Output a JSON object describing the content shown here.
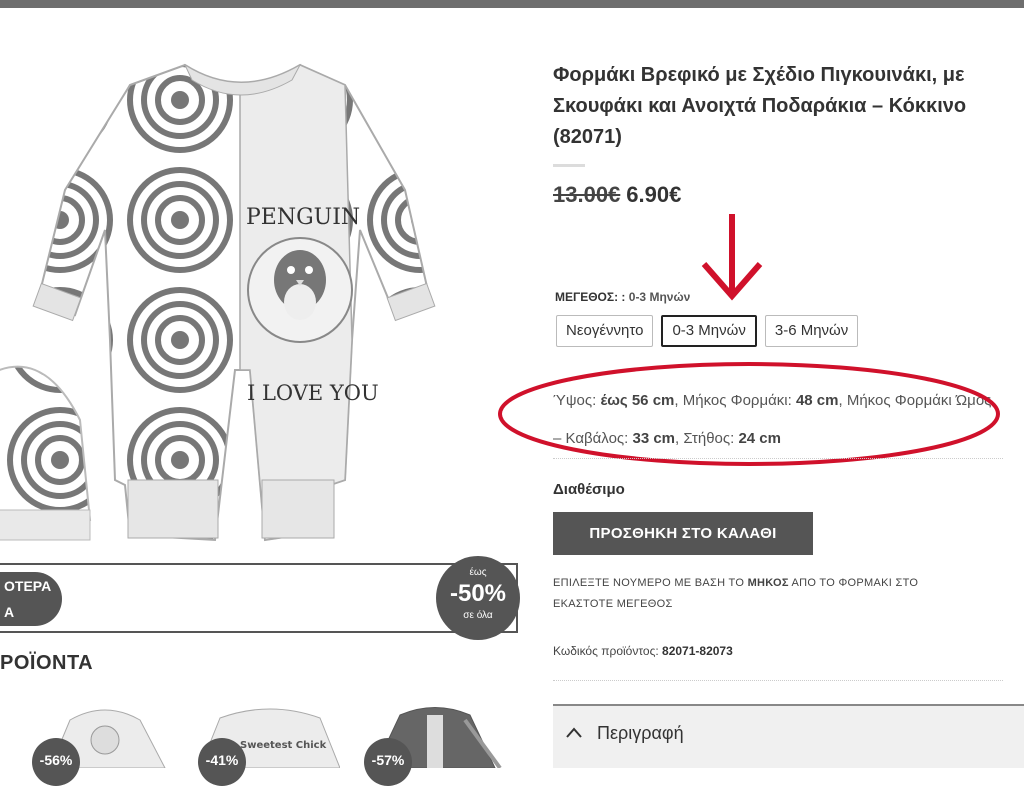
{
  "product": {
    "title": "Φορμάκι Βρεφικό με Σχέδιο Πιγκουινάκι, με Σκουφάκι και Ανοιχτά Ποδαράκια – Κόκκινο (82071)",
    "price_old": "13.00€",
    "price_new": "6.90€",
    "image_texts": {
      "penguin": "PENGUIN",
      "love": "I LOVE YOU"
    },
    "size": {
      "label": "ΜΕΓΕΘΟΣ: :",
      "selected_value": "0-3 Μηνών",
      "options": [
        "Νεογέννητο",
        "0-3 Μηνών",
        "3-6 Μηνών"
      ]
    },
    "dimensions": {
      "height_label": "Ύψος: ",
      "height_value": "έως 56 cm",
      "length_label": ", Μήκος Φορμάκι: ",
      "length_value": "48 cm",
      "line2_prefix": ", Μήκος Φορμάκι Ώμος – Καβάλος: ",
      "shoulder_value": "33 cm",
      "chest_label": ", Στήθος: ",
      "chest_value": "24 cm"
    },
    "availability": "Διαθέσιμο",
    "add_to_cart": "ΠΡΟΣΘΗΚΗ ΣΤΟ ΚΑΛΑΘΙ",
    "note_part1": "ΕΠΙΛΕΞΤΕ ΝΟΥΜΕΡΟ ΜΕ ΒΑΣΗ ΤΟ ",
    "note_bold": "ΜΗΚΟΣ",
    "note_part2": " ΑΠΟ ΤΟ ΦΟΡΜΑΚΙ ΣΤΟ ΕΚΑΣΤΟΤΕ ΜΕΓΕΘΟΣ",
    "sku_label": "Κωδικός προϊόντος: ",
    "sku_value": "82071-82073",
    "description_tab": "Περιγραφή"
  },
  "promo": {
    "pill_line1": "ΟΤΕΡΑ",
    "pill_line2": "Α",
    "badge_top": "έως",
    "badge_value": "-50%",
    "badge_bottom": "σε όλα"
  },
  "related": {
    "title": "ΡΟΪΟΝΤΑ",
    "items": [
      {
        "discount": "-56%"
      },
      {
        "discount": "-41%",
        "print": "Sweetest Chick"
      },
      {
        "discount": "-57%"
      }
    ]
  },
  "colors": {
    "annotation_red": "#d0112b",
    "button_gray": "#555555"
  }
}
